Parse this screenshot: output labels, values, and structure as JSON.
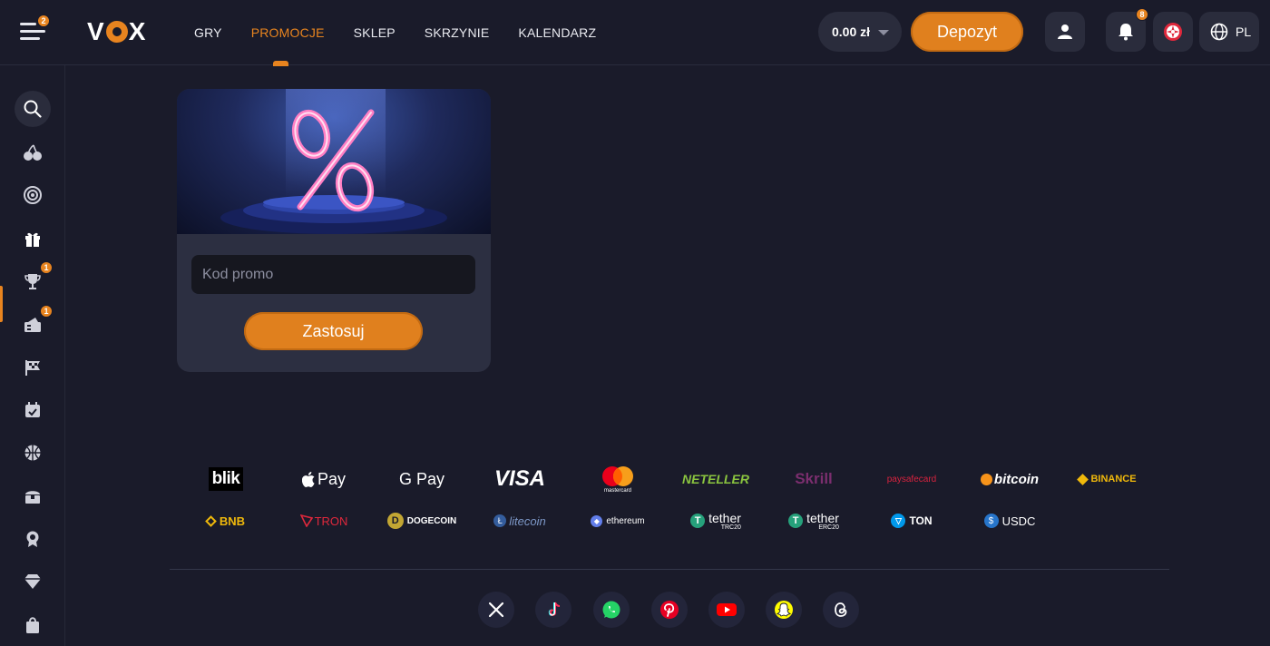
{
  "header": {
    "menu_badge": "2",
    "logo": "VOX",
    "nav": [
      {
        "label": "GRY",
        "active": false
      },
      {
        "label": "PROMOCJE",
        "active": true
      },
      {
        "label": "SKLEP",
        "active": false
      },
      {
        "label": "SKRZYNIE",
        "active": false
      },
      {
        "label": "KALENDARZ",
        "active": false
      }
    ],
    "balance": "0.00 zł",
    "deposit_label": "Depozyt",
    "notifications_badge": "8",
    "language": "PL"
  },
  "sidebar": {
    "items": [
      {
        "icon": "search-icon"
      },
      {
        "icon": "cherries-icon"
      },
      {
        "icon": "casino-chip-icon"
      },
      {
        "icon": "gift-icon",
        "active": true
      },
      {
        "icon": "trophy-icon",
        "badge": "1"
      },
      {
        "icon": "ticket-icon",
        "badge": "1"
      },
      {
        "icon": "race-flag-icon"
      },
      {
        "icon": "calendar-icon"
      },
      {
        "icon": "basketball-icon"
      },
      {
        "icon": "treasure-chest-icon"
      },
      {
        "icon": "award-icon"
      },
      {
        "icon": "diamond-icon"
      },
      {
        "icon": "shopping-bag-icon"
      }
    ]
  },
  "promo": {
    "placeholder": "Kod promo",
    "apply_label": "Zastosuj"
  },
  "payments": {
    "row1": [
      "blik",
      "Pay",
      "G Pay",
      "VISA",
      "mastercard",
      "NETELLER",
      "Skrill",
      "paysafecard",
      "bitcoin",
      "BINANCE"
    ],
    "row2": [
      "BNB",
      "TRON",
      "DOGECOIN",
      "litecoin",
      "ethereum",
      "tether",
      "tether",
      "TON",
      "USDC"
    ],
    "row2_sub": [
      "",
      "",
      "",
      "",
      "",
      "TRC20",
      "ERC20",
      "",
      ""
    ]
  },
  "social": [
    "x-icon",
    "tiktok-icon",
    "whatsapp-icon",
    "pinterest-icon",
    "youtube-icon",
    "snapchat-icon",
    "threads-icon"
  ],
  "colors": {
    "accent": "#e8841f",
    "background": "#1a1b2a",
    "card": "#2c2f41"
  }
}
